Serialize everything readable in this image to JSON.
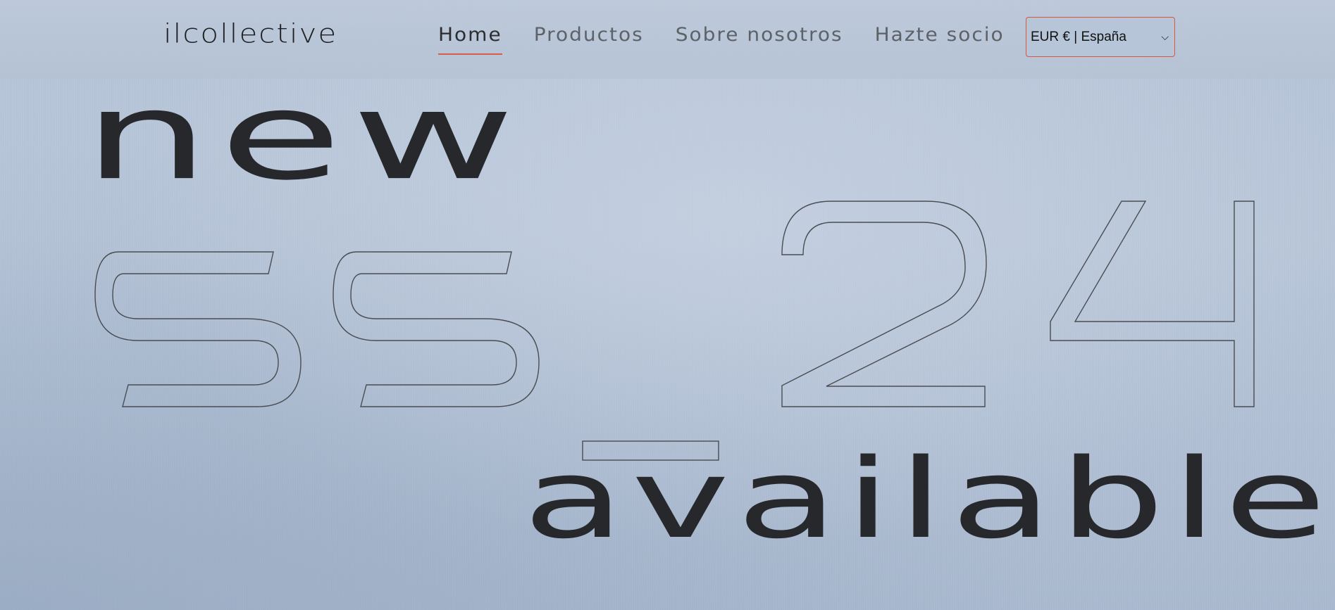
{
  "header": {
    "logo": "ilcollective",
    "nav": [
      {
        "label": "Home",
        "active": true
      },
      {
        "label": "Productos",
        "active": false
      },
      {
        "label": "Sobre nosotros",
        "active": false
      },
      {
        "label": "Hazte socio",
        "active": false
      }
    ],
    "locale_selected": "EUR € | España"
  },
  "hero": {
    "line1": "new",
    "line2": "ss_24",
    "line3": "available"
  },
  "colors": {
    "accent": "#d9573d",
    "text_dark": "#26282c",
    "background": "#b6c4d8"
  }
}
